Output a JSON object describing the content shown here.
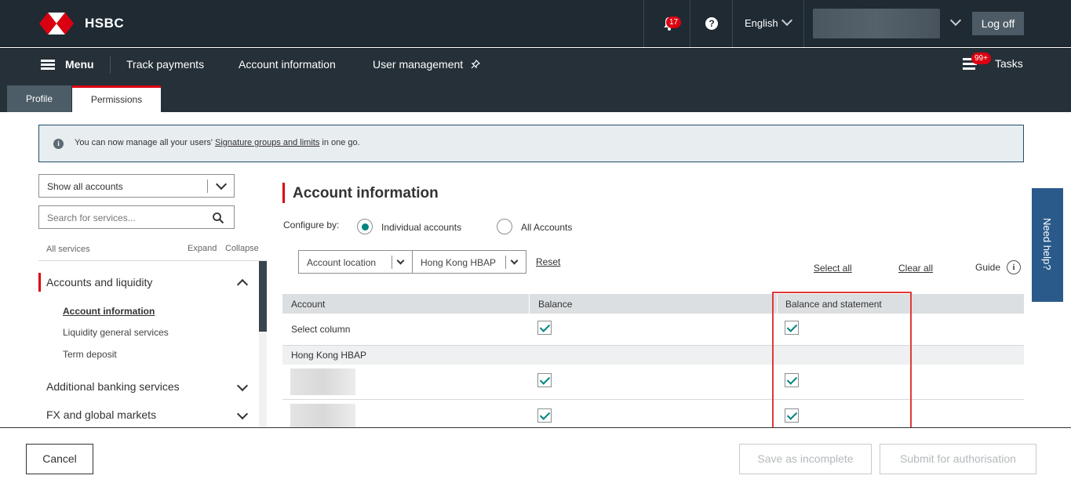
{
  "header": {
    "logo_text": "HSBC",
    "notification_count": "17",
    "language": "English",
    "logoff_label": "Log off"
  },
  "nav": {
    "menu_label": "Menu",
    "items": [
      "Track payments",
      "Account information",
      "User management"
    ],
    "tasks_label": "Tasks",
    "tasks_count": "99+"
  },
  "tabs": [
    {
      "label": "Profile",
      "active": false
    },
    {
      "label": "Permissions",
      "active": true
    }
  ],
  "notice": {
    "text_before": "You can now manage all your users'",
    "link": "Signature groups and limits",
    "text_after": "in one go."
  },
  "sidebar": {
    "filter_value": "Show all accounts",
    "search_placeholder": "Search for services...",
    "all_services": "All services",
    "expand": "Expand",
    "collapse": "Collapse",
    "groups": [
      {
        "label": "Accounts and liquidity",
        "expanded": true,
        "items": [
          "Account information",
          "Liquidity general services",
          "Term deposit"
        ]
      },
      {
        "label": "Additional banking services",
        "expanded": false
      },
      {
        "label": "FX and global markets",
        "expanded": false
      }
    ]
  },
  "main": {
    "title": "Account information",
    "configure_by": "Configure by:",
    "radio_individual": "Individual accounts",
    "radio_all": "All Accounts",
    "location_label": "Account location",
    "location_value": "Hong Kong HBAP",
    "reset": "Reset",
    "select_all": "Select all",
    "clear_all": "Clear all",
    "guide": "Guide"
  },
  "table": {
    "headers": [
      "Account",
      "Balance",
      "Balance and statement"
    ],
    "select_column": "Select column",
    "group_label": "Hong Kong HBAP"
  },
  "need_help": "Need help?",
  "footer": {
    "cancel": "Cancel",
    "save": "Save as incomplete",
    "submit": "Submit for authorisation"
  },
  "colors": {
    "brand_red": "#db0011",
    "accent_teal": "#00847f",
    "topbar": "#1f2a33"
  }
}
